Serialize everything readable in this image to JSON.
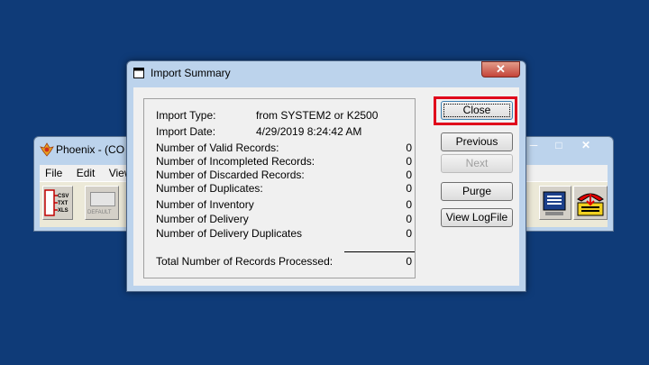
{
  "background_window": {
    "title": "Phoenix - (CO",
    "menu": [
      "File",
      "Edit",
      "View"
    ],
    "toolbar_default_label": "DEFAULT",
    "export_labels": [
      "CSV",
      "TXT",
      "XLS"
    ]
  },
  "dialog": {
    "title": "Import Summary",
    "rows": [
      {
        "label": "Import Type:",
        "value": "from SYSTEM2 or K2500"
      },
      {
        "label": "Import Date:",
        "value": "4/29/2019 8:24:42 AM"
      }
    ],
    "counts": [
      {
        "label": "Number of Valid Records:",
        "value": "0"
      },
      {
        "label": "Number of Incompleted Records:",
        "value": "0"
      },
      {
        "label": "Number of Discarded Records:",
        "value": "0"
      },
      {
        "label": "Number of Duplicates:",
        "value": "0"
      },
      {
        "label": "Number of Inventory",
        "value": "0"
      },
      {
        "label": "Number of Delivery",
        "value": "0"
      },
      {
        "label": "Number of Delivery Duplicates",
        "value": "0"
      }
    ],
    "total": {
      "label": "Total Number of Records Processed:",
      "value": "0"
    },
    "buttons": {
      "close": "Close",
      "previous": "Previous",
      "next": "Next",
      "purge": "Purge",
      "view_log": "View LogFile"
    },
    "highlight_color": "#e0001b"
  }
}
